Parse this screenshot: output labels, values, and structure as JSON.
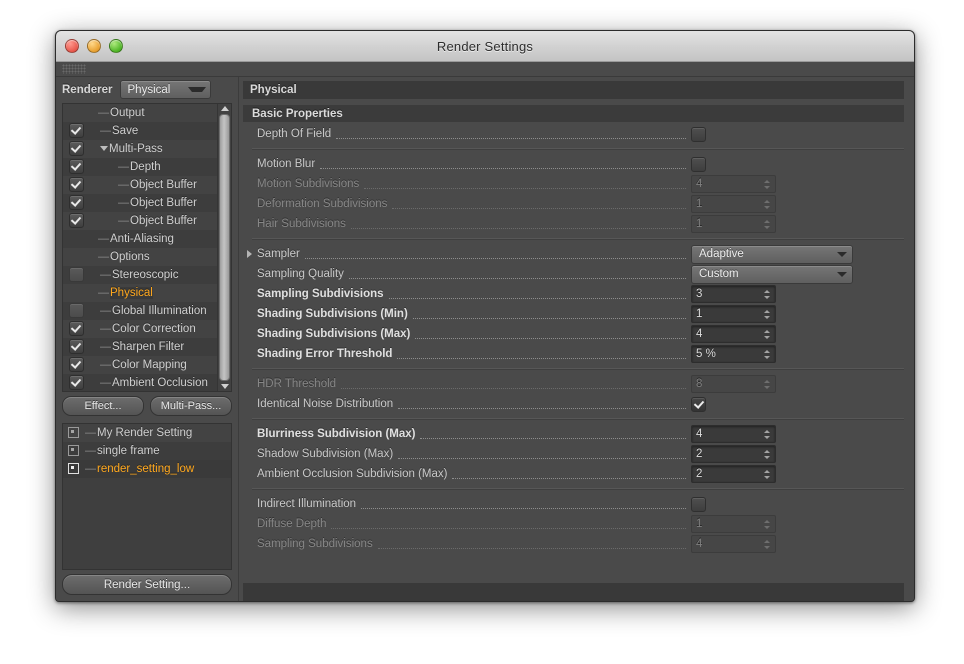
{
  "window": {
    "title": "Render Settings",
    "traffic_lights": [
      "close",
      "minimize",
      "maximize"
    ]
  },
  "sidebar": {
    "renderer_label": "Renderer",
    "renderer_value": "Physical",
    "tree": [
      {
        "label": "Output",
        "check": "none",
        "indent": 1,
        "marker": "dash"
      },
      {
        "label": "Save",
        "check": "on",
        "indent": 1,
        "marker": "dash"
      },
      {
        "label": "Multi-Pass",
        "check": "on",
        "indent": 1,
        "marker": "disclosure"
      },
      {
        "label": "Depth",
        "check": "on",
        "indent": 2,
        "marker": "dash"
      },
      {
        "label": "Object Buffer",
        "check": "on",
        "indent": 2,
        "marker": "dash"
      },
      {
        "label": "Object Buffer",
        "check": "on",
        "indent": 2,
        "marker": "dash"
      },
      {
        "label": "Object Buffer",
        "check": "on",
        "indent": 2,
        "marker": "dash"
      },
      {
        "label": "Anti-Aliasing",
        "check": "none",
        "indent": 1,
        "marker": "dash"
      },
      {
        "label": "Options",
        "check": "none",
        "indent": 1,
        "marker": "dash"
      },
      {
        "label": "Stereoscopic",
        "check": "off",
        "indent": 1,
        "marker": "dash"
      },
      {
        "label": "Physical",
        "check": "none",
        "indent": 1,
        "marker": "dash",
        "active": true
      },
      {
        "label": "Global Illumination",
        "check": "off",
        "indent": 1,
        "marker": "dash"
      },
      {
        "label": "Color Correction",
        "check": "on",
        "indent": 1,
        "marker": "dash"
      },
      {
        "label": "Sharpen Filter",
        "check": "on",
        "indent": 1,
        "marker": "dash"
      },
      {
        "label": "Color Mapping",
        "check": "on",
        "indent": 1,
        "marker": "dash"
      },
      {
        "label": "Ambient Occlusion",
        "check": "on",
        "indent": 1,
        "marker": "dash"
      }
    ],
    "effect_button": "Effect...",
    "multipass_button": "Multi-Pass...",
    "render_settings_list": [
      {
        "label": "My Render Setting",
        "selected": false
      },
      {
        "label": "single frame",
        "selected": false
      },
      {
        "label": "render_setting_low",
        "selected": true
      }
    ],
    "render_setting_button": "Render Setting..."
  },
  "content": {
    "header": "Physical",
    "sections": [
      {
        "title": "Basic Properties",
        "rows": [
          {
            "label": "Depth Of Field",
            "type": "checkbox",
            "value": false,
            "dim": false,
            "bold": false
          }
        ]
      },
      {
        "title": null,
        "rows": [
          {
            "label": "Motion Blur",
            "type": "checkbox",
            "value": false,
            "dim": false,
            "bold": false
          },
          {
            "label": "Motion Subdivisions",
            "type": "number",
            "value": "4",
            "dim": true,
            "bold": false
          },
          {
            "label": "Deformation Subdivisions",
            "type": "number",
            "value": "1",
            "dim": true,
            "bold": false
          },
          {
            "label": "Hair Subdivisions",
            "type": "number",
            "value": "1",
            "dim": true,
            "bold": false
          }
        ]
      },
      {
        "title": null,
        "rows": [
          {
            "label": "Sampler",
            "type": "dropdown",
            "value": "Adaptive",
            "dim": false,
            "bold": false,
            "triangle": true
          },
          {
            "label": "Sampling Quality",
            "type": "dropdown",
            "value": "Custom",
            "dim": false,
            "bold": false
          },
          {
            "label": "Sampling Subdivisions",
            "type": "number",
            "value": "3",
            "dim": false,
            "bold": true
          },
          {
            "label": "Shading Subdivisions (Min)",
            "type": "number",
            "value": "1",
            "dim": false,
            "bold": true
          },
          {
            "label": "Shading Subdivisions (Max)",
            "type": "number",
            "value": "4",
            "dim": false,
            "bold": true
          },
          {
            "label": "Shading Error Threshold",
            "type": "number",
            "value": "5 %",
            "dim": false,
            "bold": true
          }
        ]
      },
      {
        "title": null,
        "rows": [
          {
            "label": "HDR Threshold",
            "type": "number",
            "value": "8",
            "dim": true,
            "bold": false
          },
          {
            "label": "Identical Noise Distribution",
            "type": "checkbox",
            "value": true,
            "dim": false,
            "bold": false
          }
        ]
      },
      {
        "title": null,
        "rows": [
          {
            "label": "Blurriness Subdivision (Max)",
            "type": "number",
            "value": "4",
            "dim": false,
            "bold": true
          },
          {
            "label": "Shadow Subdivision (Max)",
            "type": "number",
            "value": "2",
            "dim": false,
            "bold": false
          },
          {
            "label": "Ambient Occlusion Subdivision (Max)",
            "type": "number",
            "value": "2",
            "dim": false,
            "bold": false
          }
        ]
      },
      {
        "title": null,
        "rows": [
          {
            "label": "Indirect Illumination",
            "type": "checkbox",
            "value": false,
            "dim": false,
            "bold": false
          },
          {
            "label": "Diffuse Depth",
            "type": "number",
            "value": "1",
            "dim": true,
            "bold": false
          },
          {
            "label": "Sampling Subdivisions",
            "type": "number",
            "value": "4",
            "dim": true,
            "bold": false
          }
        ]
      }
    ]
  }
}
